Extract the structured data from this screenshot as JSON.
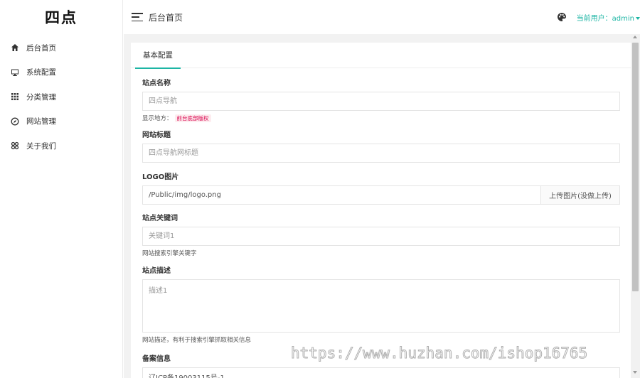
{
  "app": {
    "logo": "四点"
  },
  "sidebar": {
    "items": [
      {
        "label": "后台首页",
        "icon": "home-icon"
      },
      {
        "label": "系统配置",
        "icon": "monitor-icon"
      },
      {
        "label": "分类管理",
        "icon": "grid-icon"
      },
      {
        "label": "网站管理",
        "icon": "compass-icon"
      },
      {
        "label": "关于我们",
        "icon": "clover-icon"
      }
    ]
  },
  "header": {
    "title": "后台首页",
    "user_label": "当前用户：admin",
    "palette_icon": "palette-icon"
  },
  "tabs": {
    "active": "基本配置"
  },
  "form": {
    "site_name": {
      "label": "站点名称",
      "placeholder": "四点导航",
      "help_prefix": "显示地方：",
      "help_tag": "前台底部版权"
    },
    "site_title": {
      "label": "网站标题",
      "placeholder": "四点导航网标题"
    },
    "logo": {
      "label": "LOGO图片",
      "value": "/Public/img/logo.png",
      "upload_button": "上传图片(没做上传)"
    },
    "keywords": {
      "label": "站点关键词",
      "placeholder": "关键词1",
      "help": "网站搜索引擎关键字"
    },
    "description": {
      "label": "站点描述",
      "placeholder": "描述1",
      "help": "网站描述，有利于搜索引擎抓取相关信息"
    },
    "icp": {
      "label": "备案信息",
      "value": "辽ICP备19003115号-1"
    }
  },
  "watermark": "https://www.huzhan.com/ishop16765",
  "colors": {
    "accent": "#1cb5a4",
    "tag_bg": "#fdecef",
    "tag_text": "#d9004c"
  }
}
